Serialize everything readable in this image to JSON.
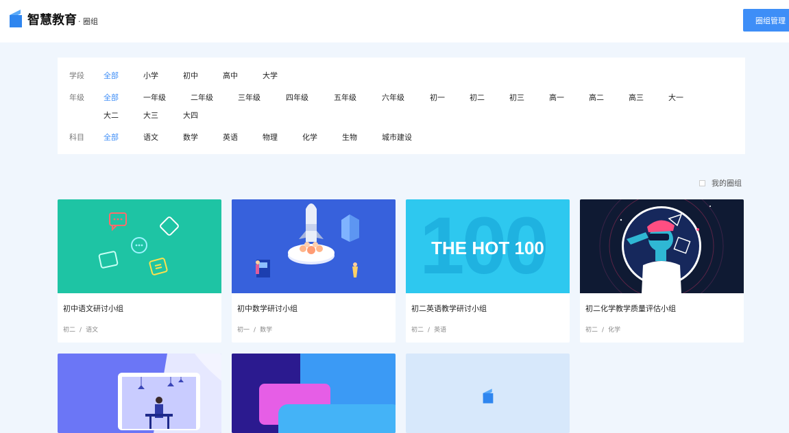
{
  "header": {
    "brand_name": "智慧教育",
    "brand_sub": "· 圈组",
    "manage_button": "圈组管理",
    "accent": "#3e8ef7"
  },
  "filters": {
    "stage": {
      "label": "学段",
      "options": [
        "全部",
        "小学",
        "初中",
        "高中",
        "大学"
      ],
      "selected": "全部"
    },
    "grade": {
      "label": "年级",
      "options": [
        "全部",
        "一年级",
        "二年级",
        "三年级",
        "四年级",
        "五年级",
        "六年级",
        "初一",
        "初二",
        "初三",
        "高一",
        "高二",
        "高三",
        "大一",
        "大二",
        "大三",
        "大四"
      ],
      "selected": "全部"
    },
    "subject": {
      "label": "科目",
      "options": [
        "全部",
        "语文",
        "数学",
        "英语",
        "物理",
        "化学",
        "生物",
        "城市建设"
      ],
      "selected": "全部"
    }
  },
  "my_groups": {
    "label": "我的圈组",
    "checked": false
  },
  "cards": [
    {
      "title": "初中语文研讨小组",
      "grade": "初二",
      "subject": "语文",
      "separator": "/"
    },
    {
      "title": "初中数学研讨小组",
      "grade": "初一",
      "subject": "数学",
      "separator": "/"
    },
    {
      "title": "初二英语教学研讨小组",
      "grade": "初二",
      "subject": "英语",
      "separator": "/",
      "cover_text": "THE HOT 100",
      "cover_bg_text": "100"
    },
    {
      "title": "初二化学教学质量评估小组",
      "grade": "初二",
      "subject": "化学",
      "separator": "/"
    }
  ],
  "cover_colors": {
    "card1": "#1ec4a4",
    "card2": "#3a66e0",
    "card3": "#2ec8ef",
    "card4": "#0f1a33",
    "card5": "#6b76f6",
    "card6": "#3b9af5",
    "card7": "#d7e8fb"
  }
}
